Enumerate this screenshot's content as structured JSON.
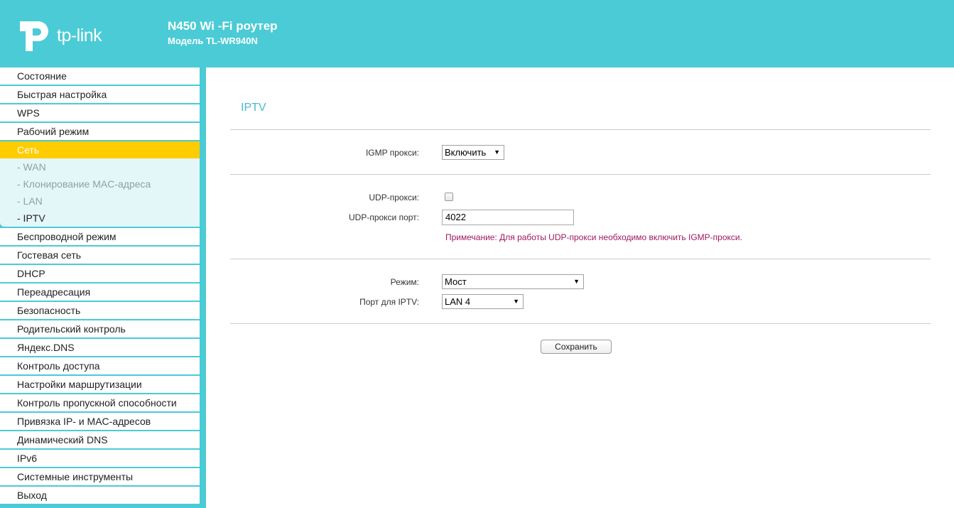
{
  "header": {
    "logo_text": "tp-link",
    "title": "N450 Wi -Fi роутер",
    "model": "Модель TL-WR940N",
    "bg_color": "#4acbd6"
  },
  "sidebar": {
    "items_before": [
      "Состояние",
      "Быстрая настройка",
      "WPS",
      "Рабочий режим"
    ],
    "active": "Сеть",
    "submenu": [
      "- WAN",
      "- Клонирование MAC-адреса",
      "- LAN",
      "- IPTV"
    ],
    "current_sub": "- IPTV",
    "items_after": [
      "Беспроводной режим",
      "Гостевая сеть",
      "DHCP",
      "Переадресация",
      "Безопасность",
      "Родительский контроль",
      "Яндекс.DNS",
      "Контроль доступа",
      "Настройки маршрутизации",
      "Контроль пропускной способности",
      "Привязка IP- и MAC-адресов",
      "Динамический DNS",
      "IPv6",
      "Системные инструменты",
      "Выход"
    ],
    "active_color": "#ffcc00"
  },
  "main": {
    "title": "IPTV",
    "igmp_label": "IGMP прокси:",
    "igmp_value": "Включить",
    "udp_proxy_label": "UDP-прокси:",
    "udp_proxy_checked": false,
    "udp_port_label": "UDP-прокси порт:",
    "udp_port_value": "4022",
    "note": "Примечание: Для работы UDP-прокси необходимо включить IGMP-прокси.",
    "mode_label": "Режим:",
    "mode_value": "Мост",
    "port_label": "Порт для IPTV:",
    "port_value": "LAN 4",
    "save_label": "Сохранить"
  }
}
